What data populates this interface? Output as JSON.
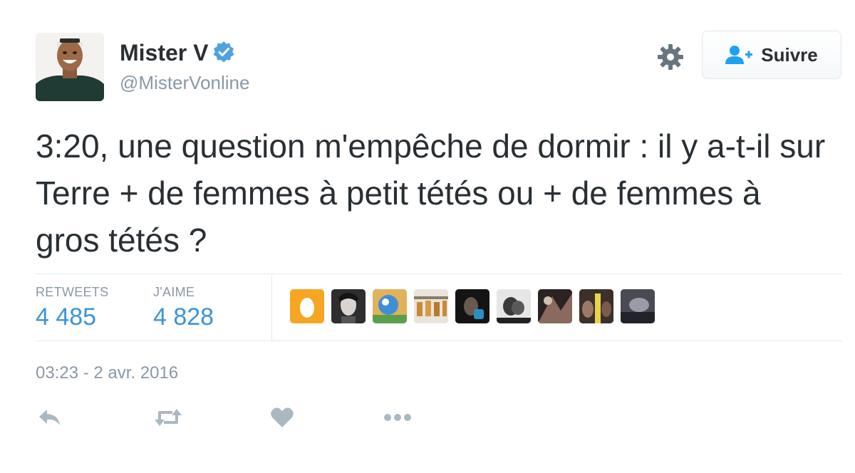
{
  "user": {
    "display_name": "Mister V",
    "screen_name": "@MisterVonline",
    "verified_icon": "verified-badge-icon"
  },
  "header": {
    "settings_icon": "gear-icon",
    "follow_label": "Suivre",
    "follow_icon": "follow-user-icon"
  },
  "tweet": {
    "text": "3:20, une question m'empêche de dormir : il y a-t-il sur Terre + de femmes à petit tétés ou + de femmes à gros tétés ?"
  },
  "stats": {
    "retweets_label": "RETWEETS",
    "retweets_value": "4 485",
    "likes_label": "J'AIME",
    "likes_value": "4 828"
  },
  "timestamp": "03:23 - 2 avr. 2016",
  "actions": [
    {
      "name": "reply-icon"
    },
    {
      "name": "retweet-icon"
    },
    {
      "name": "like-icon"
    },
    {
      "name": "more-icon"
    }
  ],
  "colors": {
    "accent": "#3b94d9",
    "muted": "#8899a6",
    "text": "#292f33",
    "action_icon": "#aab8c2"
  }
}
